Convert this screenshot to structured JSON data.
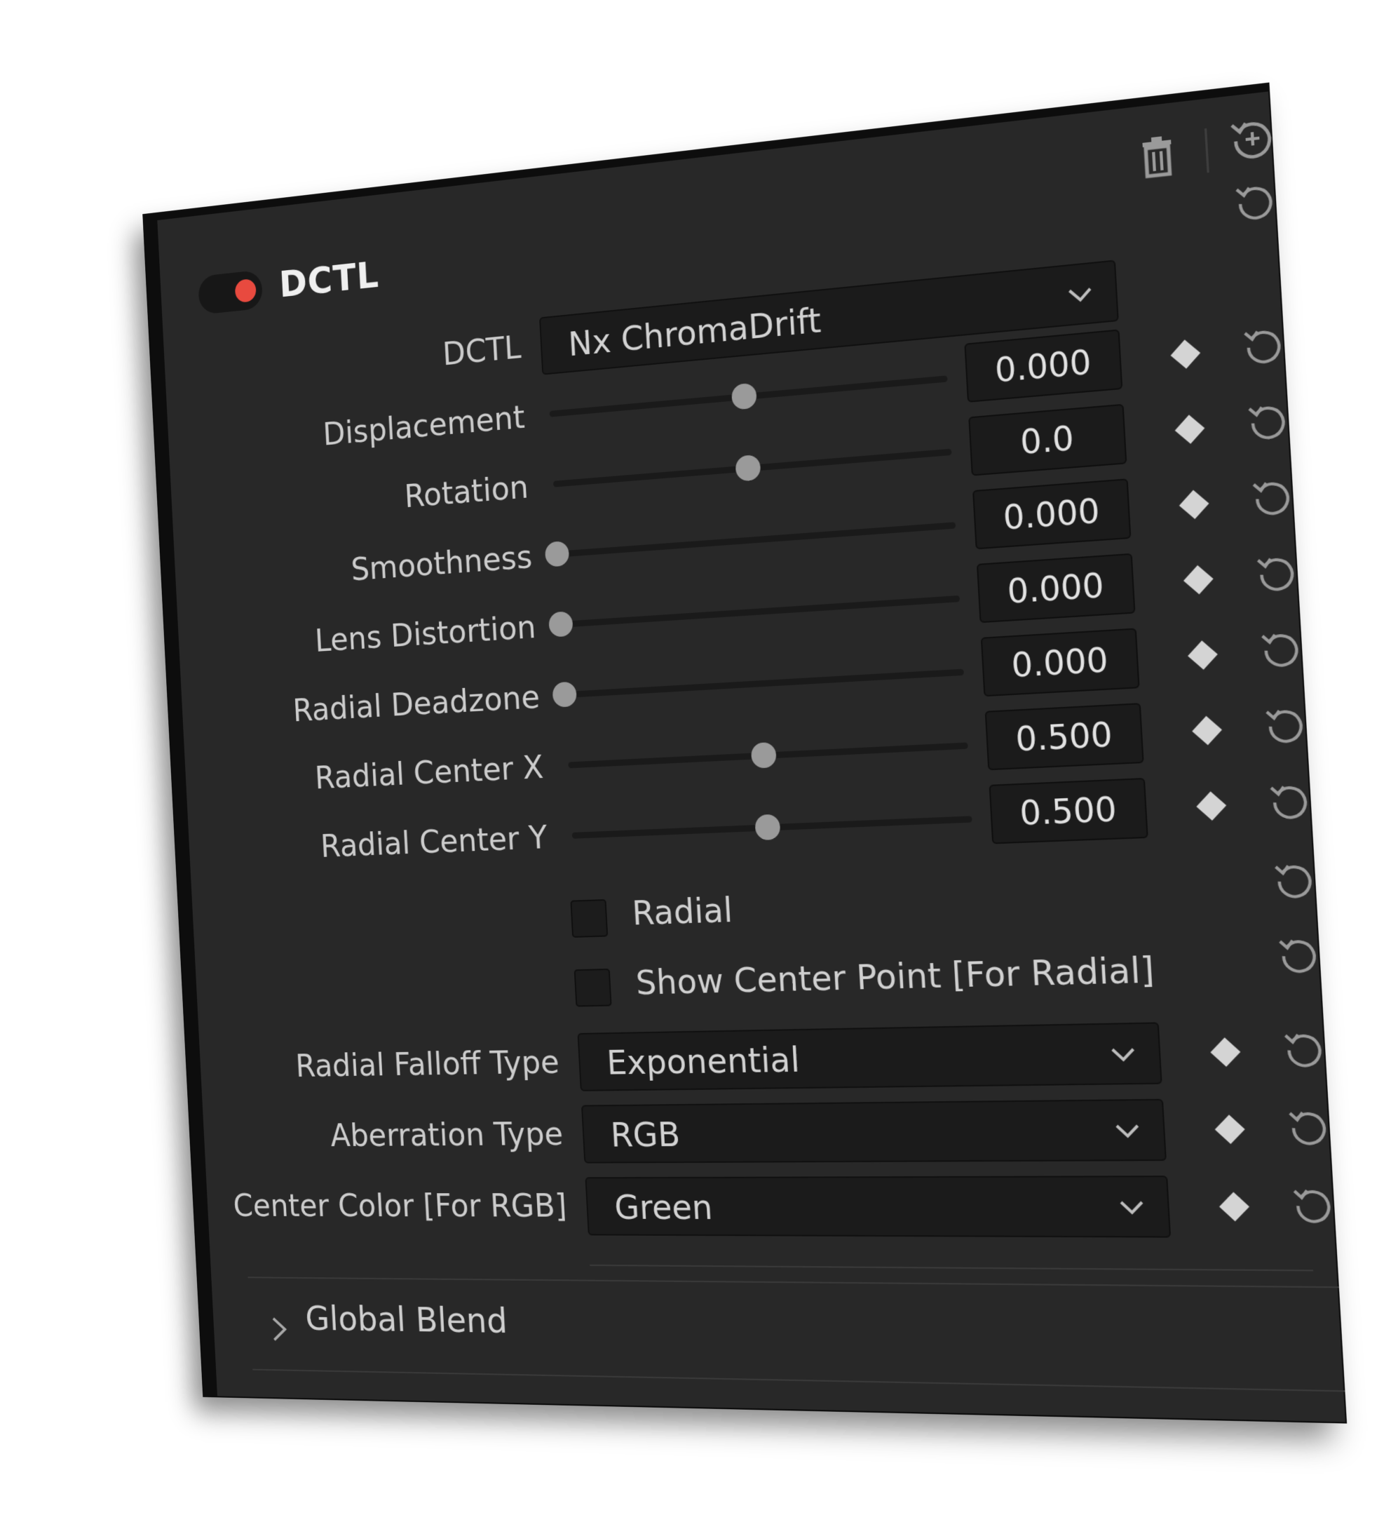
{
  "header": {
    "title": "DCTL",
    "enabled": true,
    "accent_color": "#e84a3f"
  },
  "icons": {
    "delete": "trash-icon",
    "reset_all": "reset-add-icon",
    "reset": "reset-icon",
    "keyframe": "keyframe-diamond-icon",
    "dropdown": "chevron-down-icon",
    "expand": "chevron-right-icon"
  },
  "dctl_select": {
    "label": "DCTL",
    "value": "Nx ChromaDrift"
  },
  "params": [
    {
      "label": "Displacement",
      "value": "0.000",
      "position": 0.5
    },
    {
      "label": "Rotation",
      "value": "0.0",
      "position": 0.5
    },
    {
      "label": "Smoothness",
      "value": "0.000",
      "position": 0.0
    },
    {
      "label": "Lens Distortion",
      "value": "0.000",
      "position": 0.0
    },
    {
      "label": "Radial Deadzone",
      "value": "0.000",
      "position": 0.0
    },
    {
      "label": "Radial Center X",
      "value": "0.500",
      "position": 0.5
    },
    {
      "label": "Radial Center Y",
      "value": "0.500",
      "position": 0.5
    }
  ],
  "checkboxes": [
    {
      "label": "Radial",
      "checked": false
    },
    {
      "label": "Show Center Point [For Radial]",
      "checked": false
    }
  ],
  "selects": [
    {
      "label": "Radial Falloff Type",
      "value": "Exponential"
    },
    {
      "label": "Aberration Type",
      "value": "RGB"
    },
    {
      "label": "Center Color [For RGB]",
      "value": "Green"
    }
  ],
  "section": {
    "label": "Global Blend",
    "expanded": false
  }
}
